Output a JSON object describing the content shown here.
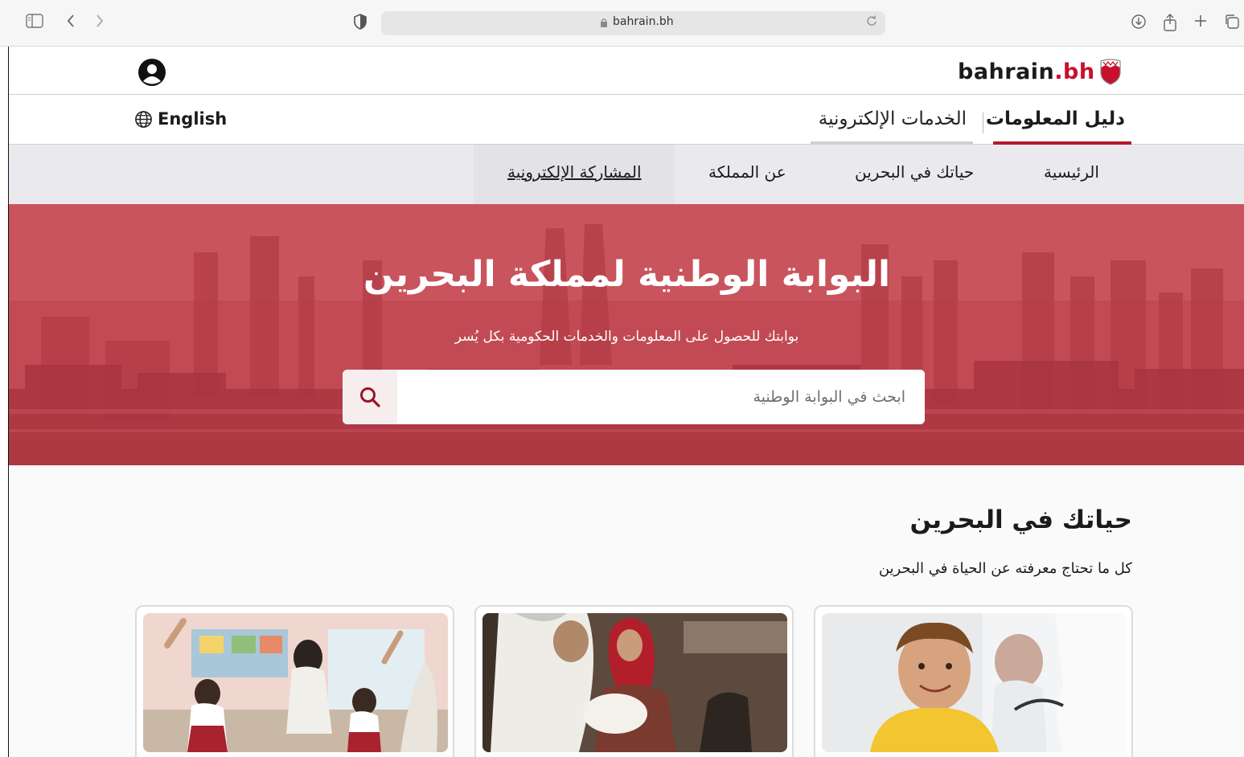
{
  "browser": {
    "url": "bahrain.bh",
    "icons": [
      "sidebar-icon",
      "back-icon",
      "forward-icon",
      "shield-icon",
      "lock-icon",
      "reload-icon",
      "download-icon",
      "share-icon",
      "new-tab-icon",
      "tabs-overview-icon"
    ]
  },
  "header": {
    "logo_text": "bahrain",
    "logo_suffix": ".bh",
    "account_icon": "user-icon"
  },
  "tabs": {
    "language_label": "English",
    "items": [
      {
        "label": "دليل المعلومات",
        "active": true
      },
      {
        "label": "الخدمات الإلكترونية",
        "active": false
      }
    ]
  },
  "nav": {
    "items": [
      {
        "label": "الرئيسية"
      },
      {
        "label": "حياتك في البحرين"
      },
      {
        "label": "عن المملكة"
      },
      {
        "label": "المشاركة الإلكترونية"
      }
    ]
  },
  "hero": {
    "title": "البوابة الوطنية لمملكة البحرين",
    "subtitle": "بوابتك للحصول على المعلومات والخدمات الحكومية بكل يُسر",
    "search_placeholder": "ابحث في البوابة الوطنية"
  },
  "section": {
    "title": "حياتك في البحرين",
    "subtitle": "كل ما تحتاج معرفته عن الحياة في البحرين",
    "cards": [
      {
        "image": "child-with-doctor"
      },
      {
        "image": "family-with-newborn"
      },
      {
        "image": "classroom-students"
      }
    ]
  },
  "colors": {
    "accent": "#b3192b",
    "hero_overlay": "#c2454f",
    "nav_background": "#eaeaee"
  }
}
